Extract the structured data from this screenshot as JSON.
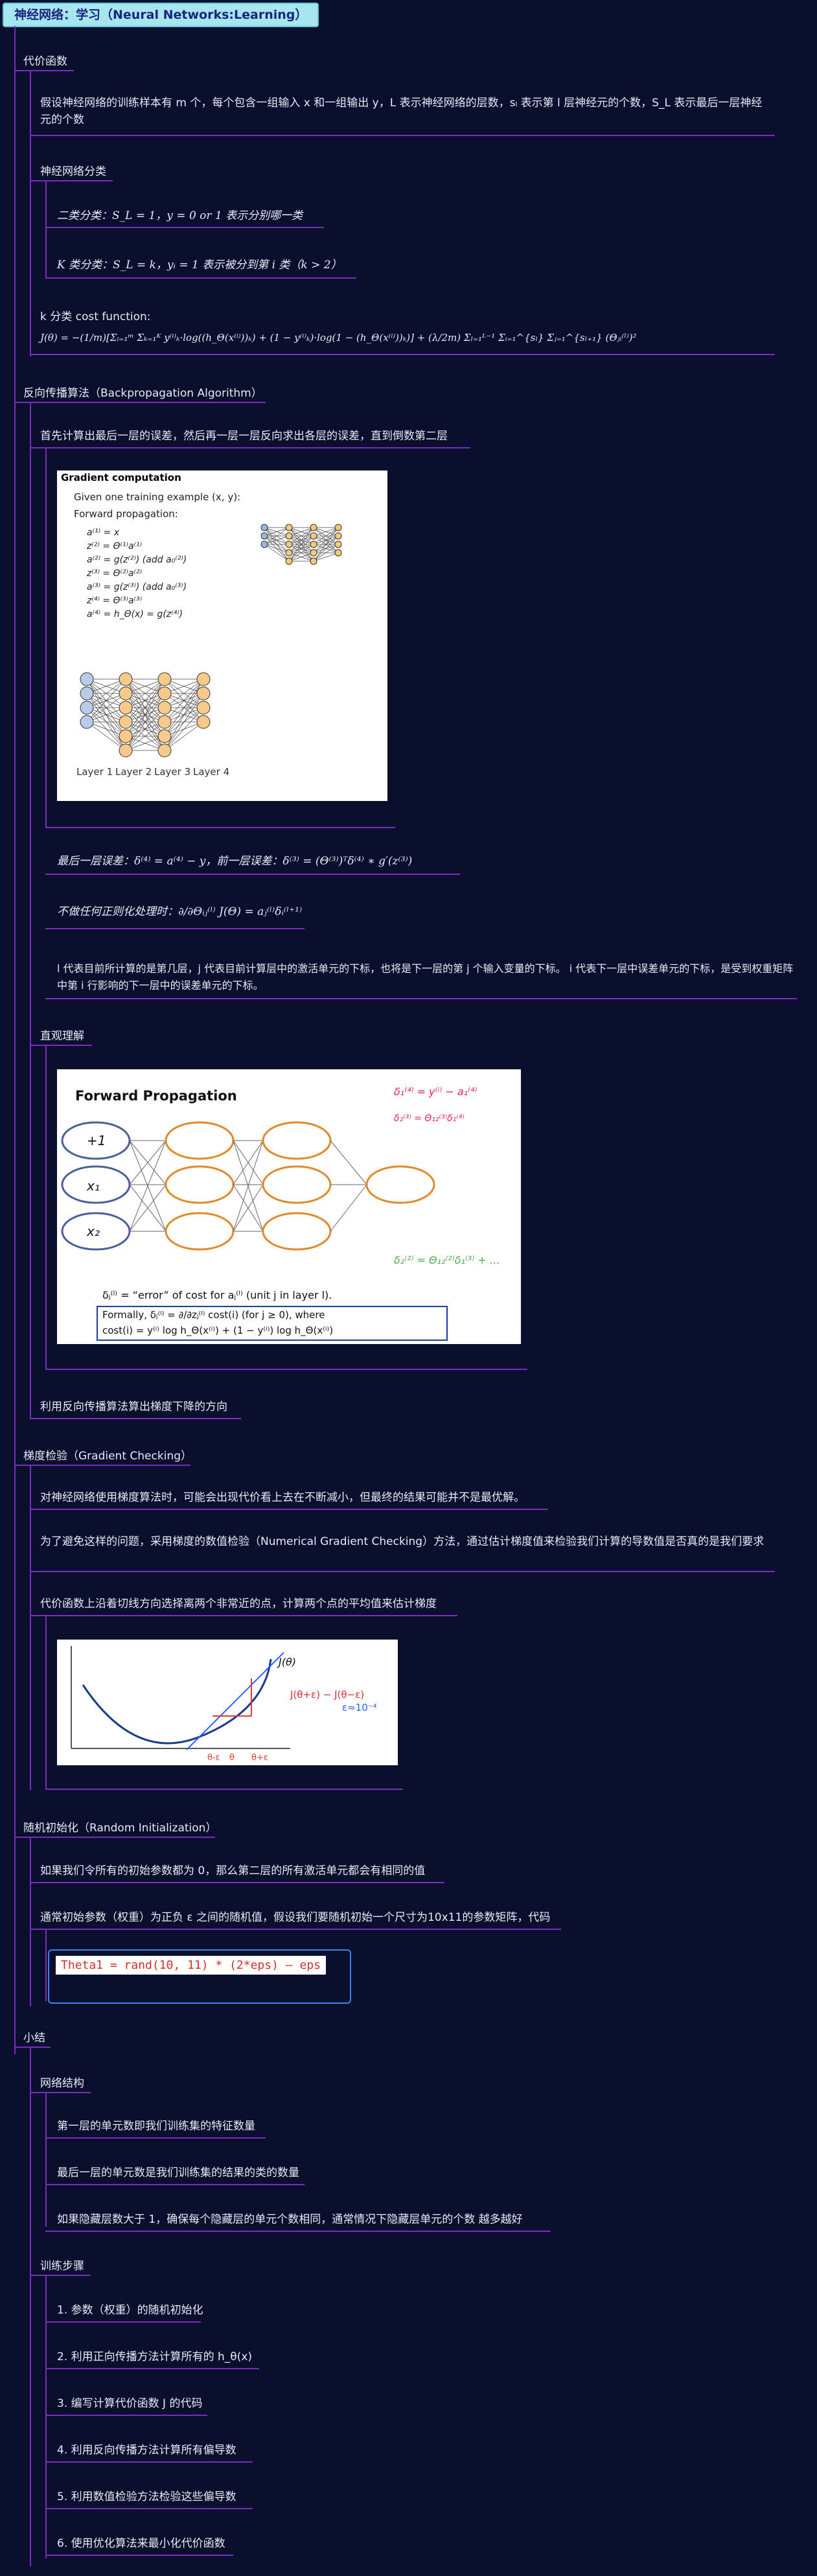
{
  "root": "神经网络：学习（Neural Networks:Learning）",
  "s1": {
    "title": "代价函数",
    "p1": "假设神经网络的训练样本有 m 个，每个包含一组输入 x 和一组输出 y，L 表示神经网络的层数，sₗ 表示第 l 层神经元的个数，S_L 表示最后一层神经元的个数",
    "cls_title": "神经网络分类",
    "c1": "二类分类：S_L = 1，y = 0 or 1 表示分别哪一类",
    "c2": "K 类分类：S_L = k，yᵢ = 1 表示被分到第 i 类（k > 2）",
    "cost_label": "k 分类 cost function:",
    "cost_formula": "J(θ) = −(1/m)[Σᵢ₌₁ᵐ Σₖ₌₁ᴷ y⁽ⁱ⁾ₖ·log((h_Θ(x⁽ⁱ⁾))ₖ) + (1 − y⁽ⁱ⁾ₖ)·log(1 − (h_Θ(x⁽ⁱ⁾))ₖ)] + (λ/2m) Σₗ₌₁ᴸ⁻¹ Σᵢ₌₁^{sₗ} Σⱼ₌₁^{sₗ₊₁} (Θⱼᵢ⁽ˡ⁾)²"
  },
  "s2": {
    "title": "反向传播算法（Backpropagation Algorithm）",
    "p1": "首先计算出最后一层的误差，然后再一层一层反向求出各层的误差，直到倒数第二层",
    "img1": {
      "title": "Gradient computation",
      "line1": "Given one training example (x, y):",
      "line2": "Forward propagation:",
      "eqs": [
        "a⁽¹⁾ = x",
        "z⁽²⁾ = Θ⁽¹⁾a⁽¹⁾",
        "a⁽²⁾ = g(z⁽²⁾)  (add a₀⁽²⁾)",
        "z⁽³⁾ = Θ⁽²⁾a⁽²⁾",
        "a⁽³⁾ = g(z⁽³⁾)  (add a₀⁽³⁾)",
        "z⁽⁴⁾ = Θ⁽³⁾a⁽³⁾",
        "a⁽⁴⁾ = h_Θ(x) = g(z⁽⁴⁾)"
      ],
      "layers": [
        "Layer 1",
        "Layer 2",
        "Layer 3",
        "Layer 4"
      ]
    },
    "d1": "最后一层误差：δ⁽⁴⁾ = a⁽⁴⁾ − y，前一层误差：δ⁽³⁾ = (Θ⁽³⁾)ᵀδ⁽⁴⁾ ∗ g′(z⁽³⁾)",
    "d2": "不做任何正则化处理时：∂/∂Θᵢⱼ⁽ˡ⁾ J(Θ) = aⱼ⁽ˡ⁾δᵢ⁽ˡ⁺¹⁾",
    "d3": "l 代表目前所计算的是第几层，j 代表目前计算层中的激活单元的下标，也将是下一层的第 j 个输入变量的下标。 i 代表下一层中误差单元的下标，是受到权重矩阵中第 i 行影响的下一层中的误差单元的下标。",
    "intuition": "直观理解",
    "img2": {
      "title": "Forward Propagation",
      "nodes": [
        "+1",
        "x₁",
        "x₂"
      ],
      "delta_def": "δⱼ⁽ˡ⁾ = “error” of cost for aⱼ⁽ˡ⁾ (unit j in layer l).",
      "formally": "Formally, δⱼ⁽ˡ⁾ = ∂/∂zⱼ⁽ˡ⁾ cost(i)  (for j ≥ 0), where",
      "cost_i": "cost(i) = y⁽ⁱ⁾ log h_Θ(x⁽ⁱ⁾) + (1 − y⁽ⁱ⁾) log h_Θ(x⁽ⁱ⁾)"
    },
    "grad_dir": "利用反向传播算法算出梯度下降的方向"
  },
  "s3": {
    "title": "梯度检验（Gradient Checking）",
    "p1": "对神经网络使用梯度算法时，可能会出现代价看上去在不断减小，但最终的结果可能并不是最优解。",
    "p2": "为了避免这样的问题，采用梯度的数值检验（Numerical Gradient Checking）方法，通过估计梯度值来检验我们计算的导数值是否真的是我们要求",
    "p3": "代价函数上沿着切线方向选择离两个非常近的点，计算两个点的平均值来估计梯度",
    "img3": {
      "label": "J(θ)",
      "ticks": [
        "θ-ε",
        "θ",
        "θ+ε"
      ]
    }
  },
  "s4": {
    "title": "随机初始化（Random Initialization）",
    "p1": "如果我们令所有的初始参数都为 0，那么第二层的所有激活单元都会有相同的值",
    "p2": "通常初始参数（权重）为正负 ε 之间的随机值，假设我们要随机初始一个尺寸为10x11的参数矩阵，代码",
    "code": "Theta1 = rand(10, 11) * (2*eps) – eps"
  },
  "s5": {
    "title": "小结",
    "net_title": "网络结构",
    "net": [
      "第一层的单元数即我们训练集的特征数量",
      "最后一层的单元数是我们训练集的结果的类的数量",
      "如果隐藏层数大于 1，确保每个隐藏层的单元个数相同，通常情况下隐藏层单元的个数 越多越好"
    ],
    "train_title": "训练步骤",
    "train": [
      "1. 参数（权重）的随机初始化",
      "2. 利用正向传播方法计算所有的 h_θ(x)",
      "3. 编写计算代价函数 J 的代码",
      "4. 利用反向传播方法计算所有偏导数",
      "5. 利用数值检验方法检验这些偏导数",
      "6. 使用优化算法来最小化代价函数"
    ]
  }
}
